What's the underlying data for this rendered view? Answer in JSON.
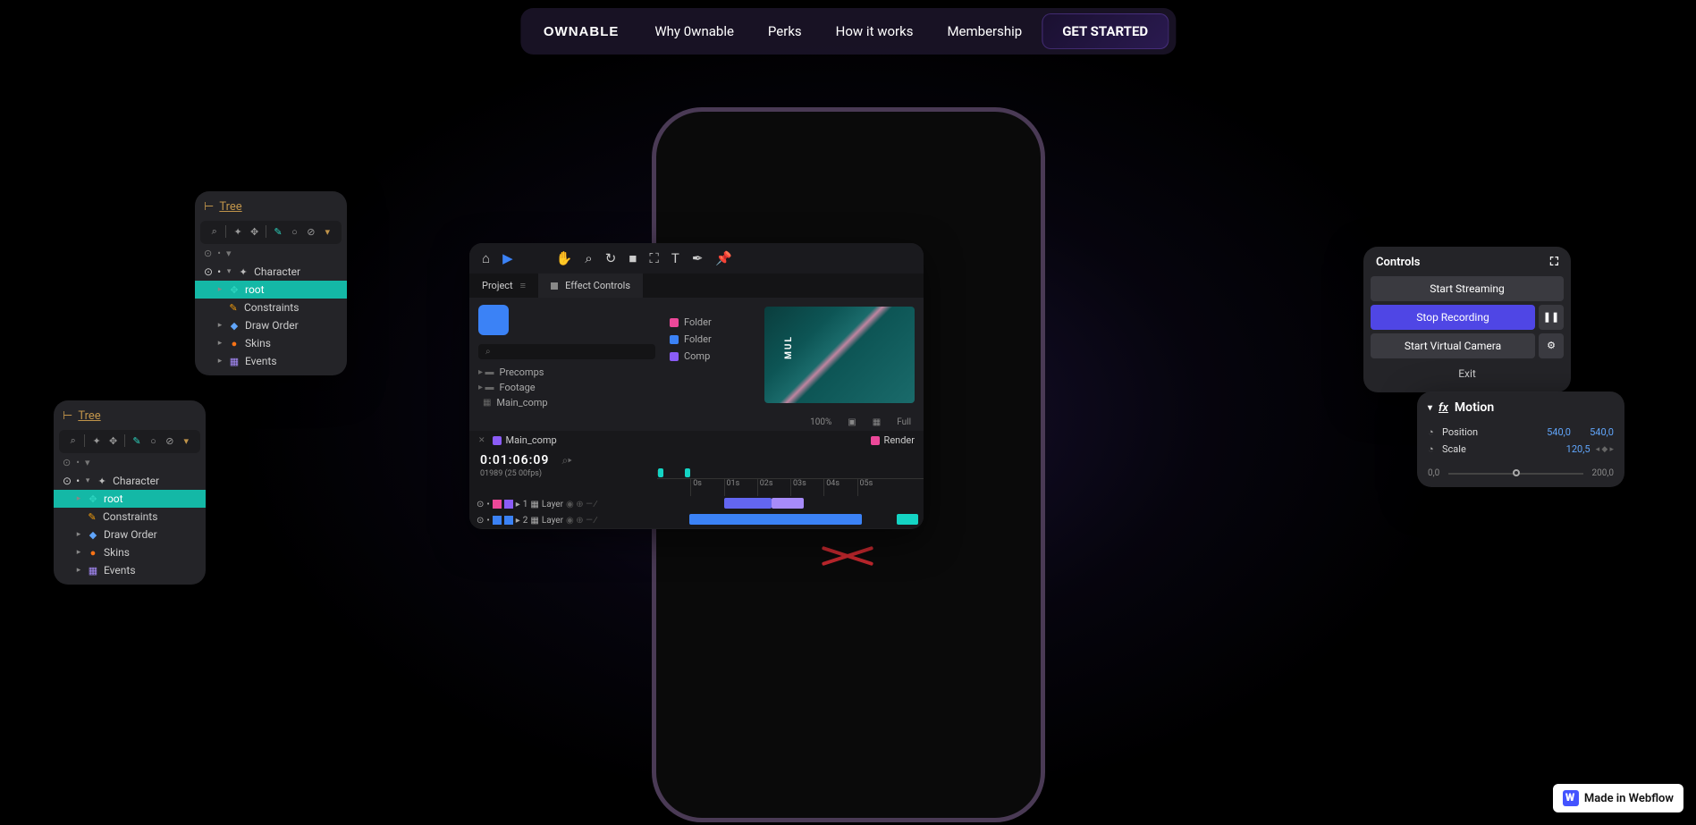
{
  "nav": {
    "logo": "OWNABLE",
    "links": [
      "Why 0wnable",
      "Perks",
      "How it works",
      "Membership"
    ],
    "cta": "GET STARTED"
  },
  "tree": {
    "title": "Tree",
    "character": "Character",
    "root": "root",
    "constraints": "Constraints",
    "draw_order": "Draw Order",
    "skins": "Skins",
    "events": "Events"
  },
  "editor": {
    "project_tab": "Project",
    "effects_tab": "Effect Controls",
    "folders": {
      "precomps": "Precomps",
      "footage": "Footage",
      "main": "Main_comp"
    },
    "labels": {
      "folder": "Folder",
      "comp": "Comp"
    },
    "zoom": "100%",
    "fit": "Full",
    "main_tab": "Main_comp",
    "render_tab": "Render",
    "timecode": "0:01:06:09",
    "fps": "01989 (25 00fps)",
    "ticks": [
      "0s",
      "01s",
      "02s",
      "03s",
      "04s",
      "05s"
    ],
    "layer": "Layer",
    "l1": "1",
    "l2": "2"
  },
  "controls": {
    "title": "Controls",
    "stream": "Start Streaming",
    "record": "Stop Recording",
    "vcam": "Start Virtual Camera",
    "exit": "Exit"
  },
  "motion": {
    "title": "Motion",
    "position": "Position",
    "pos_x": "540,0",
    "pos_y": "540,0",
    "scale": "Scale",
    "scale_v": "120,5",
    "min": "0,0",
    "max": "200,0"
  },
  "badge": "Made in Webflow"
}
